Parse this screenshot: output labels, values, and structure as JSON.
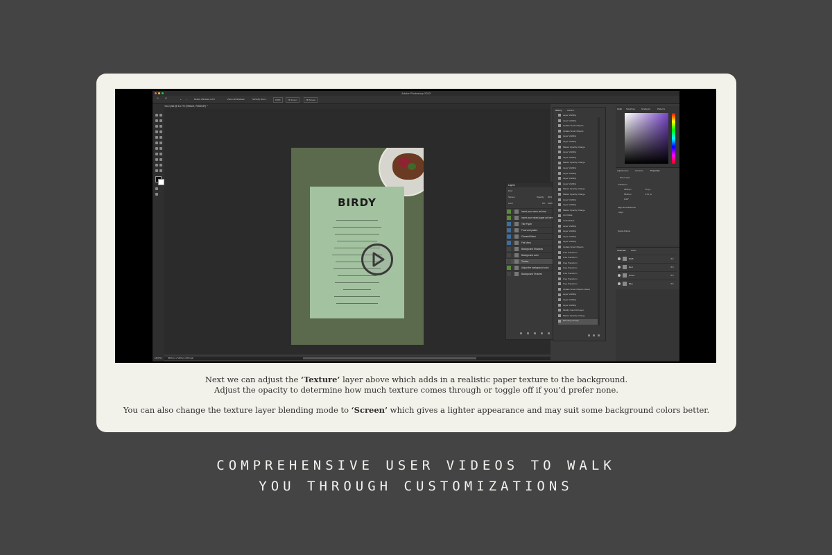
{
  "app": {
    "title": "Adobe Photoshop 2023",
    "doc_tab": "Menu 2.psd @ 16.7% (Texture, RGB/16*) *",
    "share_label": "Share",
    "options": {
      "resize_windows": "Resize Windows to Fit",
      "zoom_all": "Zoom All Windows",
      "scrubby_zoom": "Scrubby Zoom",
      "zoom_value": "100%",
      "fit_screen": "Fit Screen",
      "fill_screen": "Fill Screen"
    },
    "status": {
      "zoom": "16.67%",
      "size": "3600 px x 5400 px (300 ppi)"
    },
    "document": {
      "logo": "BIRDY"
    }
  },
  "layers_panel": {
    "tab": "Layers",
    "filter": "Kind",
    "blend_mode": "Screen",
    "opacity_label": "Opacity:",
    "opacity_value": "30%",
    "lock_label": "Lock:",
    "fill_label": "Fill:",
    "fill_value": "100%",
    "layers": [
      "Insert your menu art here",
      "Insert your mixed paper art here",
      "Title Paper",
      "Food and plates",
      "Creased Menu",
      "Flat Menu",
      "Background Shadows",
      "Background color",
      "Texture",
      "Adjust the background color",
      "Background Textures"
    ]
  },
  "history_panel": {
    "tabs": [
      "History",
      "Actions"
    ],
    "items": [
      "Layer Visibility",
      "Layer Visibility",
      "Update Smart Objects",
      "Update Smart Objects",
      "Layer Visibility",
      "Layer Visibility",
      "Master Opacity Change",
      "Layer Visibility",
      "Layer Visibility",
      "Master Opacity Change",
      "Layer Visibility",
      "Layer Visibility",
      "Layer Visibility",
      "Layer Visibility",
      "Master Opacity Change",
      "Master Opacity Change",
      "Layer Visibility",
      "Layer Visibility",
      "Master Opacity Change",
      "Link Mask",
      "Unlink Mask",
      "Layer Visibility",
      "Layer Visibility",
      "Layer Visibility",
      "Layer Visibility",
      "Update Smart Objects",
      "Free Transform",
      "Free Transform",
      "Free Transform",
      "Free Transform",
      "Free Transform",
      "Free Transform",
      "Free Transform",
      "Update Smart Objects (Save)",
      "Layer Visibility",
      "Layer Visibility",
      "Layer Visibility",
      "Modify Color Fill Layer",
      "Master Opacity Change",
      "Blending Change"
    ]
  },
  "right_panel": {
    "color_tabs": [
      "Color",
      "Swatches",
      "Gradients",
      "Patterns"
    ],
    "prop_tabs": [
      "Adjustments",
      "Libraries",
      "Properties"
    ],
    "pixel_layer": "Pixel Layer",
    "transform_label": "Transform",
    "w_value": "3599 px",
    "x_value": "-97 px",
    "h_value": "5649 px",
    "y_value": "-172 px",
    "angle_value": "0.00°",
    "align_label": "Align and Distribute",
    "align_sub": "Align:",
    "quick_actions": "Quick Actions",
    "channel_tabs": [
      "Channels",
      "Paths"
    ],
    "channels": [
      {
        "name": "RGB",
        "shortcut": "⌘2"
      },
      {
        "name": "Red",
        "shortcut": "⌘3"
      },
      {
        "name": "Green",
        "shortcut": "⌘4"
      },
      {
        "name": "Blue",
        "shortcut": "⌘5"
      }
    ]
  },
  "caption": {
    "line1_pre": "Next we can adjust the ",
    "line1_bold": "‘Texture’",
    "line1_post": " layer above which adds in a realistic paper texture to the background.",
    "line2": "Adjust the opacity to determine how much texture comes through or toggle off if you’d prefer none.",
    "line3_pre": "You can also change the texture layer blending mode to ",
    "line3_bold": "‘Screen’",
    "line3_post": " which gives a lighter appearance and may suit some background colors better."
  },
  "headline": {
    "line1": "COMPREHENSIVE USER VIDEOS TO WALK",
    "line2": "YOU THROUGH CUSTOMIZATIONS"
  }
}
